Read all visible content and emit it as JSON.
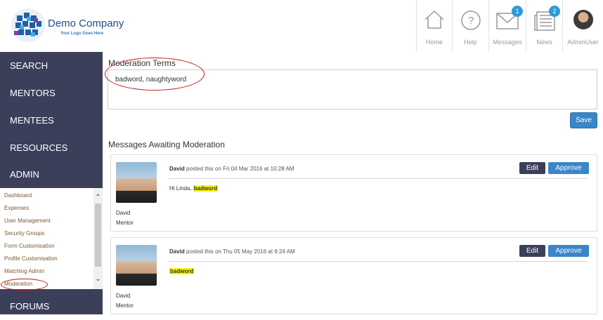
{
  "brand": {
    "name": "Demo Company",
    "tagline": "Your Logo Goes Here"
  },
  "topnav": [
    {
      "label": "Home",
      "icon": "home-icon"
    },
    {
      "label": "Help",
      "icon": "help-icon"
    },
    {
      "label": "Messages",
      "icon": "envelope-icon",
      "badge": "1"
    },
    {
      "label": "News",
      "icon": "newspaper-icon",
      "badge": "2"
    },
    {
      "label": "AdminUser",
      "icon": "avatar"
    }
  ],
  "sidebar": {
    "items": [
      "Search",
      "Mentors",
      "Mentees",
      "Resources",
      "Admin",
      "Forums"
    ],
    "admin_submenu": [
      "Dashboard",
      "Expenses",
      "User Management",
      "Security Groups",
      "Form Customisation",
      "Profile Customisation",
      "Matching Admin",
      "Moderation"
    ]
  },
  "moderation": {
    "terms_heading": "Moderation Terms",
    "terms_value": "badword, naughtyword",
    "save_label": "Save"
  },
  "awaiting": {
    "heading": "Messages Awaiting Moderation",
    "edit_label": "Edit",
    "approve_label": "Approve",
    "messages": [
      {
        "author": "David",
        "posted": "posted this on Fri 04 Mar 2016 at 10:28 AM",
        "body_prefix": "Hi Linda, ",
        "flagged": "badword",
        "user_name": "David",
        "user_role": "Mentor"
      },
      {
        "author": "David",
        "posted": "posted this on Thu 05 May 2016 at 9:24 AM",
        "body_prefix": "",
        "flagged": "badword",
        "user_name": "David",
        "user_role": "Mentor"
      }
    ]
  },
  "colors": {
    "sidebar_bg": "#3b3f5a",
    "accent": "#3a86c8",
    "highlight": "#f5f50a",
    "annotation": "#c0181c"
  }
}
